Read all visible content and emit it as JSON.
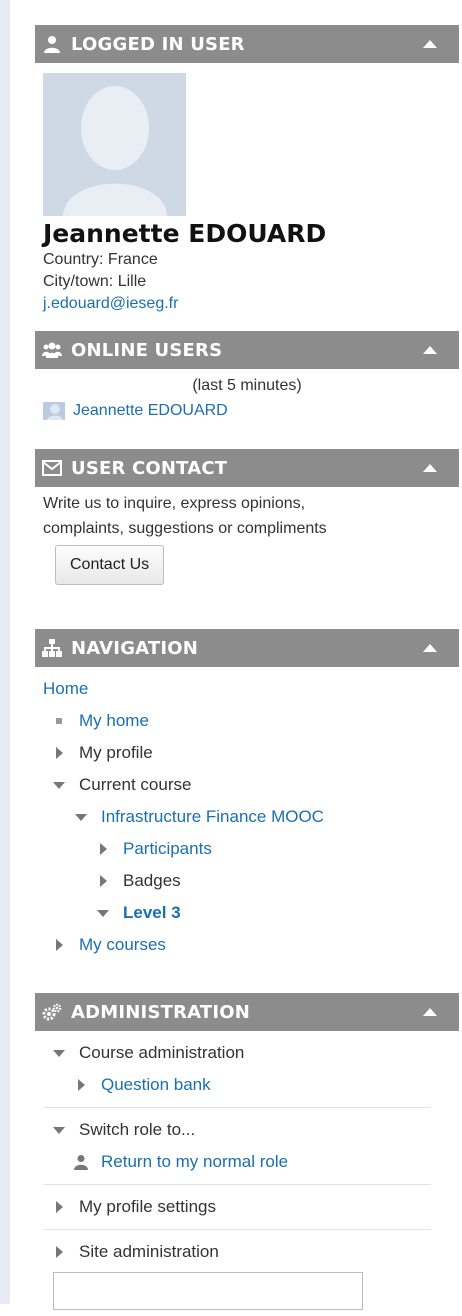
{
  "logged_in": {
    "header": "LOGGED IN USER",
    "name": "Jeannette EDOUARD",
    "country": "Country: France",
    "city": "City/town: Lille",
    "email": "j.edouard@ieseg.fr"
  },
  "online": {
    "header": "ONLINE USERS",
    "subtitle": "(last 5 minutes)",
    "users": [
      "Jeannette EDOUARD"
    ]
  },
  "contact": {
    "header": "USER CONTACT",
    "text_line1": "Write us to inquire, express opinions,",
    "text_line2": "complaints, suggestions or compliments",
    "button": "Contact Us"
  },
  "navigation": {
    "header": "NAVIGATION",
    "home": "Home",
    "my_home": "My home",
    "my_profile": "My profile",
    "current_course": "Current course",
    "course_name": "Infrastructure Finance MOOC",
    "participants": "Participants",
    "badges": "Badges",
    "level": "Level 3",
    "my_courses": "My courses"
  },
  "administration": {
    "header": "ADMINISTRATION",
    "course_admin": "Course administration",
    "question_bank": "Question bank",
    "switch_role": "Switch role to...",
    "return_role": "Return to my normal role",
    "profile_settings": "My profile settings",
    "site_admin": "Site administration",
    "search_placeholder": ""
  },
  "colors": {
    "header_bg": "#8c8c8c",
    "link": "#1a6fb2",
    "rail": "#e6eaf3"
  }
}
